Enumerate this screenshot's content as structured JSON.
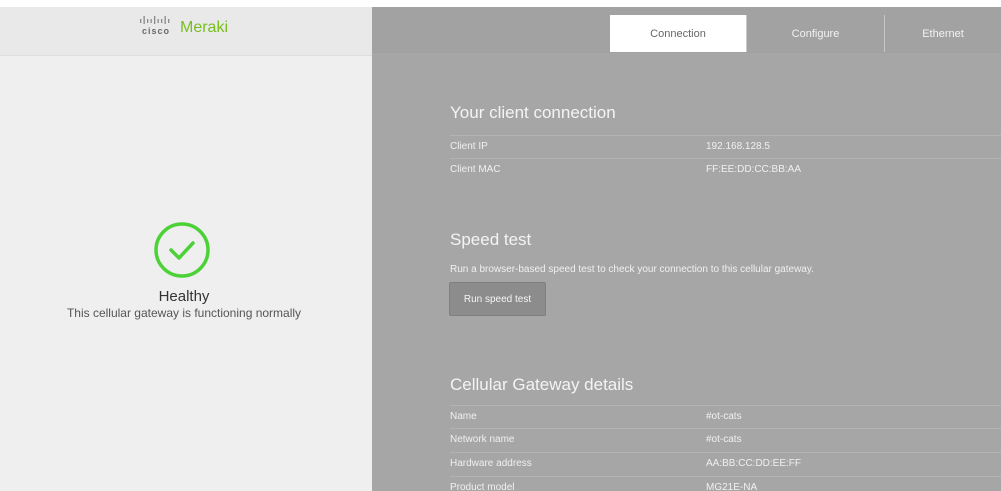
{
  "brand": {
    "cisco": "cisco",
    "meraki": "Meraki",
    "meraki_color": "#78be20"
  },
  "status": {
    "icon": "check-circle-icon",
    "icon_color": "#4cd137",
    "title": "Healthy",
    "subtitle": "This cellular gateway is functioning normally"
  },
  "tabs": [
    {
      "label": "Connection",
      "active": true
    },
    {
      "label": "Configure",
      "active": false
    },
    {
      "label": "Ethernet",
      "active": false
    }
  ],
  "client_connection": {
    "title": "Your client connection",
    "rows": [
      {
        "label": "Client IP",
        "value": "192.168.128.5"
      },
      {
        "label": "Client MAC",
        "value": "FF:EE:DD:CC:BB:AA"
      }
    ]
  },
  "speed_test": {
    "title": "Speed test",
    "description": "Run a browser-based speed test to check your connection to this cellular gateway.",
    "button_label": "Run speed test"
  },
  "gateway_details": {
    "title": "Cellular Gateway details",
    "rows": [
      {
        "label": "Name",
        "value": "#ot-cats"
      },
      {
        "label": "Network name",
        "value": "#ot-cats"
      },
      {
        "label": "Hardware address",
        "value": "AA:BB:CC:DD:EE:FF"
      },
      {
        "label": "Product model",
        "value": "MG21E-NA"
      }
    ]
  }
}
